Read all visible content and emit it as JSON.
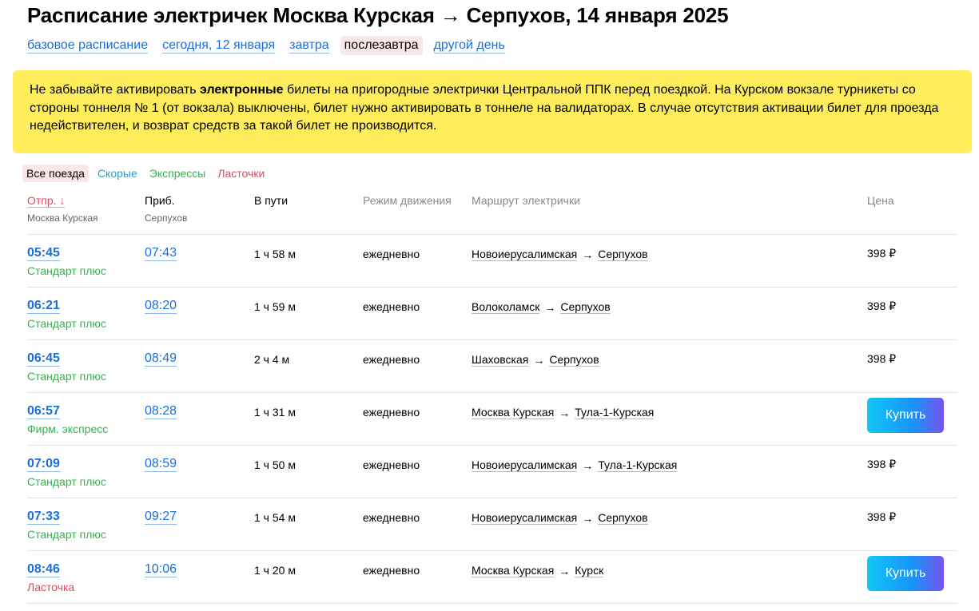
{
  "page_title": "Расписание электричек Москва Курская → Серпухов, 14 января 2025",
  "day_links": [
    {
      "label": "базовое расписание",
      "active": false
    },
    {
      "label": "сегодня, 12 января",
      "active": false
    },
    {
      "label": "завтра",
      "active": false
    },
    {
      "label": "послезавтра",
      "active": true
    },
    {
      "label": "другой день",
      "active": false
    }
  ],
  "notice": {
    "before": "Не забывайте активировать ",
    "bold": "электронные",
    "after": " билеты на пригородные электрички Центральной ППК перед поездкой. На Курском вокзале турникеты со стороны тоннеля № 1 (от вокзала) выключены, билет нужно активировать в тоннеле на валидаторах. В случае отсутствия активации билет для проезда недействителен, и возврат средств за такой билет не производится."
  },
  "filters": {
    "all": "Все поезда",
    "fast": "Скорые",
    "express": "Экспрессы",
    "lastochka": "Ласточки"
  },
  "columns": {
    "departure": "Отпр.",
    "departure_sort": "↓",
    "departure_station": "Москва Курская",
    "arrival": "Приб.",
    "arrival_station": "Серпухов",
    "duration": "В пути",
    "mode": "Режим движения",
    "route": "Маршрут электрички",
    "price": "Цена"
  },
  "route_arrow": "→",
  "trains": [
    {
      "dep": "05:45",
      "arr": "07:43",
      "type": "Стандарт плюс",
      "type_class": "std",
      "duration": "1 ч 58 м",
      "mode": "ежедневно",
      "from": "Новоиерусалимская",
      "to": "Серпухов",
      "price": "398 ₽",
      "buy": false
    },
    {
      "dep": "06:21",
      "arr": "08:20",
      "type": "Стандарт плюс",
      "type_class": "std",
      "duration": "1 ч 59 м",
      "mode": "ежедневно",
      "from": "Волоколамск",
      "to": "Серпухов",
      "price": "398 ₽",
      "buy": false
    },
    {
      "dep": "06:45",
      "arr": "08:49",
      "type": "Стандарт плюс",
      "type_class": "std",
      "duration": "2 ч 4 м",
      "mode": "ежедневно",
      "from": "Шаховская",
      "to": "Серпухов",
      "price": "398 ₽",
      "buy": false
    },
    {
      "dep": "06:57",
      "arr": "08:28",
      "type": "Фирм. экспресс",
      "type_class": "exp",
      "duration": "1 ч 31 м",
      "mode": "ежедневно",
      "from": "Москва Курская",
      "to": "Тула-1-Курская",
      "price": "",
      "buy": true
    },
    {
      "dep": "07:09",
      "arr": "08:59",
      "type": "Стандарт плюс",
      "type_class": "std",
      "duration": "1 ч 50 м",
      "mode": "ежедневно",
      "from": "Новоиерусалимская",
      "to": "Тула-1-Курская",
      "price": "398 ₽",
      "buy": false
    },
    {
      "dep": "07:33",
      "arr": "09:27",
      "type": "Стандарт плюс",
      "type_class": "std",
      "duration": "1 ч 54 м",
      "mode": "ежедневно",
      "from": "Новоиерусалимская",
      "to": "Серпухов",
      "price": "398 ₽",
      "buy": false
    },
    {
      "dep": "08:46",
      "arr": "10:06",
      "type": "Ласточка",
      "type_class": "last",
      "duration": "1 ч 20 м",
      "mode": "ежедневно",
      "from": "Москва Курская",
      "to": "Курск",
      "price": "",
      "buy": true
    }
  ],
  "buy_label": "Купить"
}
